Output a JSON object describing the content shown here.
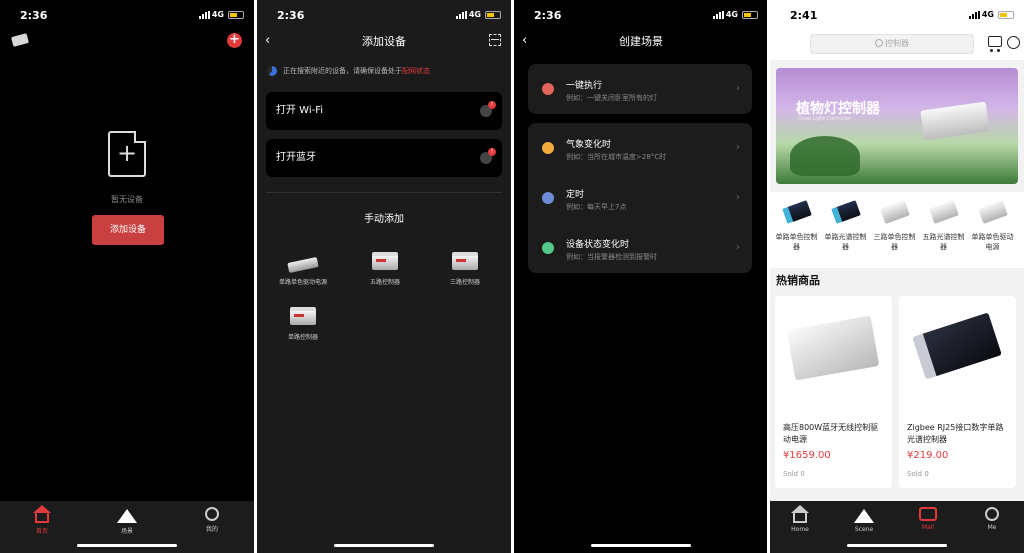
{
  "screens": {
    "home": {
      "time": "2:36",
      "network": "4G",
      "empty_text": "暂无设备",
      "add_button": "添加设备",
      "tabs": [
        {
          "label": "首页"
        },
        {
          "label": "场景"
        },
        {
          "label": "我的"
        }
      ]
    },
    "add_device": {
      "time": "2:36",
      "network": "4G",
      "title": "添加设备",
      "searching_text": "正在搜索附近的设备，请确保设备处于",
      "searching_link": "配网状态",
      "wifi_label": "打开 Wi-Fi",
      "bluetooth_label": "打开蓝牙",
      "manual_title": "手动添加",
      "products": [
        {
          "name": "单路单色驱动电源"
        },
        {
          "name": "五路控制器"
        },
        {
          "name": "三路控制器"
        },
        {
          "name": "单路控制器"
        }
      ]
    },
    "create_scene": {
      "time": "2:36",
      "network": "4G",
      "title": "创建场景",
      "items": [
        {
          "title": "一键执行",
          "subtitle": "例如：一键关闭卧室所有的灯",
          "icon": "hand-tap-icon",
          "color": "#e0645a"
        },
        {
          "title": "气象变化时",
          "subtitle": "例如：当所在城市温度>28°C时",
          "icon": "sun-icon",
          "color": "#f2a93b"
        },
        {
          "title": "定时",
          "subtitle": "例如：每天早上7点",
          "icon": "clock-icon",
          "color": "#6d8bd6"
        },
        {
          "title": "设备状态变化时",
          "subtitle": "例如：当报警器检测到报警时",
          "icon": "device-status-icon",
          "color": "#56c68a"
        }
      ]
    },
    "mall": {
      "time": "2:41",
      "network": "4G",
      "search_placeholder": "控制器",
      "banner_title": "植物灯控制器",
      "banner_subtitle": "Grow Light Controller",
      "categories": [
        {
          "name": "单路单色控制器",
          "icon": "blue"
        },
        {
          "name": "单路光谱控制器",
          "icon": "blue"
        },
        {
          "name": "三路单色控制器",
          "icon": "silver"
        },
        {
          "name": "五路光谱控制器",
          "icon": "silver"
        },
        {
          "name": "单路单色驱动电源",
          "icon": "silver"
        }
      ],
      "hot_title": "热销商品",
      "products": [
        {
          "name": "高压800W蓝牙无线控制驱动电源",
          "price": "¥1659.00",
          "sold": "Sold 0"
        },
        {
          "name": "Zigbee RJ25接口数字单路光谱控制器",
          "price": "¥219.00",
          "sold": "Sold 0"
        }
      ],
      "tabs": [
        {
          "label": "Home"
        },
        {
          "label": "Scene"
        },
        {
          "label": "Mall"
        },
        {
          "label": "Me"
        }
      ]
    }
  },
  "colors": {
    "accent": "#e23a3a",
    "button_red": "#c8403f",
    "dark_bg": "#000000",
    "card_dark": "#1c1c1c"
  }
}
